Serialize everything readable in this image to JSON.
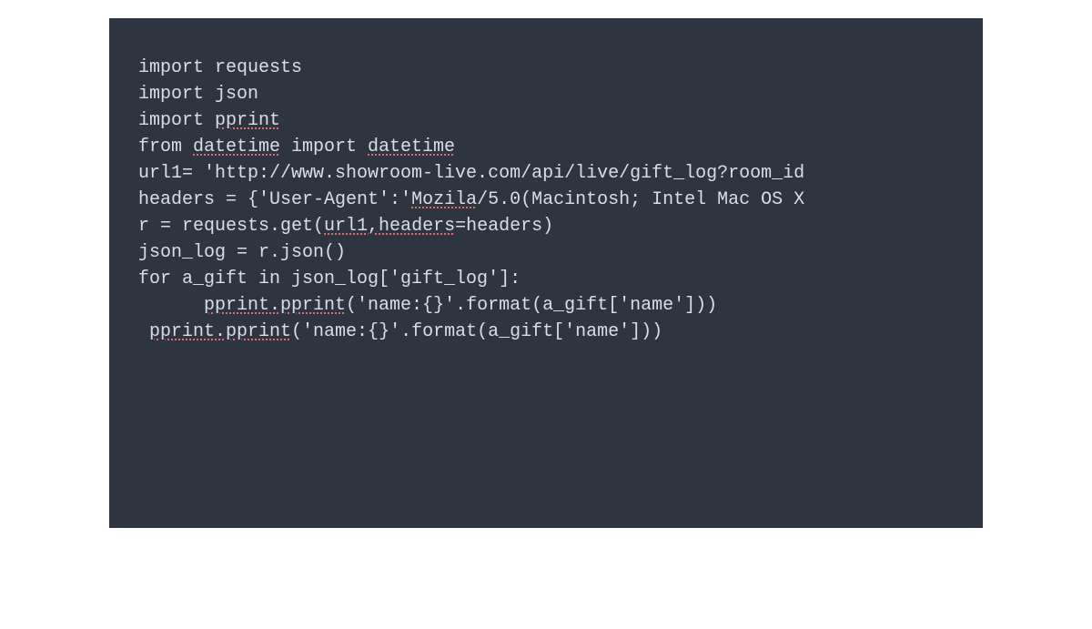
{
  "code": {
    "lines": [
      {
        "segments": [
          {
            "text": "import requests",
            "err": false
          }
        ]
      },
      {
        "segments": [
          {
            "text": "import json",
            "err": false
          }
        ]
      },
      {
        "segments": [
          {
            "text": "import ",
            "err": false
          },
          {
            "text": "pprint",
            "err": true
          }
        ]
      },
      {
        "segments": [
          {
            "text": "from ",
            "err": false
          },
          {
            "text": "datetime",
            "err": true
          },
          {
            "text": " import ",
            "err": false
          },
          {
            "text": "datetime",
            "err": true
          }
        ]
      },
      {
        "segments": [
          {
            "text": "url1= 'http://www.showroom-live.com/api/live/gift_log?room_id",
            "err": false
          }
        ]
      },
      {
        "segments": [
          {
            "text": "headers = {'User-Agent':'",
            "err": false
          },
          {
            "text": "Mozila",
            "err": true
          },
          {
            "text": "/5.0(Macintosh; Intel Mac OS X",
            "err": false
          }
        ]
      },
      {
        "segments": [
          {
            "text": "r = requests.get(",
            "err": false
          },
          {
            "text": "url1,headers",
            "err": true
          },
          {
            "text": "=headers)",
            "err": false
          }
        ]
      },
      {
        "segments": [
          {
            "text": "json_log = r.json()",
            "err": false
          }
        ]
      },
      {
        "segments": [
          {
            "text": "for a_gift in json_log['gift_log']:",
            "err": false
          }
        ]
      },
      {
        "segments": [
          {
            "text": "      ",
            "err": false
          },
          {
            "text": "pprint.pprint",
            "err": true
          },
          {
            "text": "('name:{}'.format(a_gift['name']))",
            "err": false
          }
        ]
      },
      {
        "segments": [
          {
            "text": " ",
            "err": false
          },
          {
            "text": "pprint.pprint",
            "err": true
          },
          {
            "text": "('name:{}'.format(a_gift['name']))",
            "err": false
          }
        ]
      }
    ]
  }
}
